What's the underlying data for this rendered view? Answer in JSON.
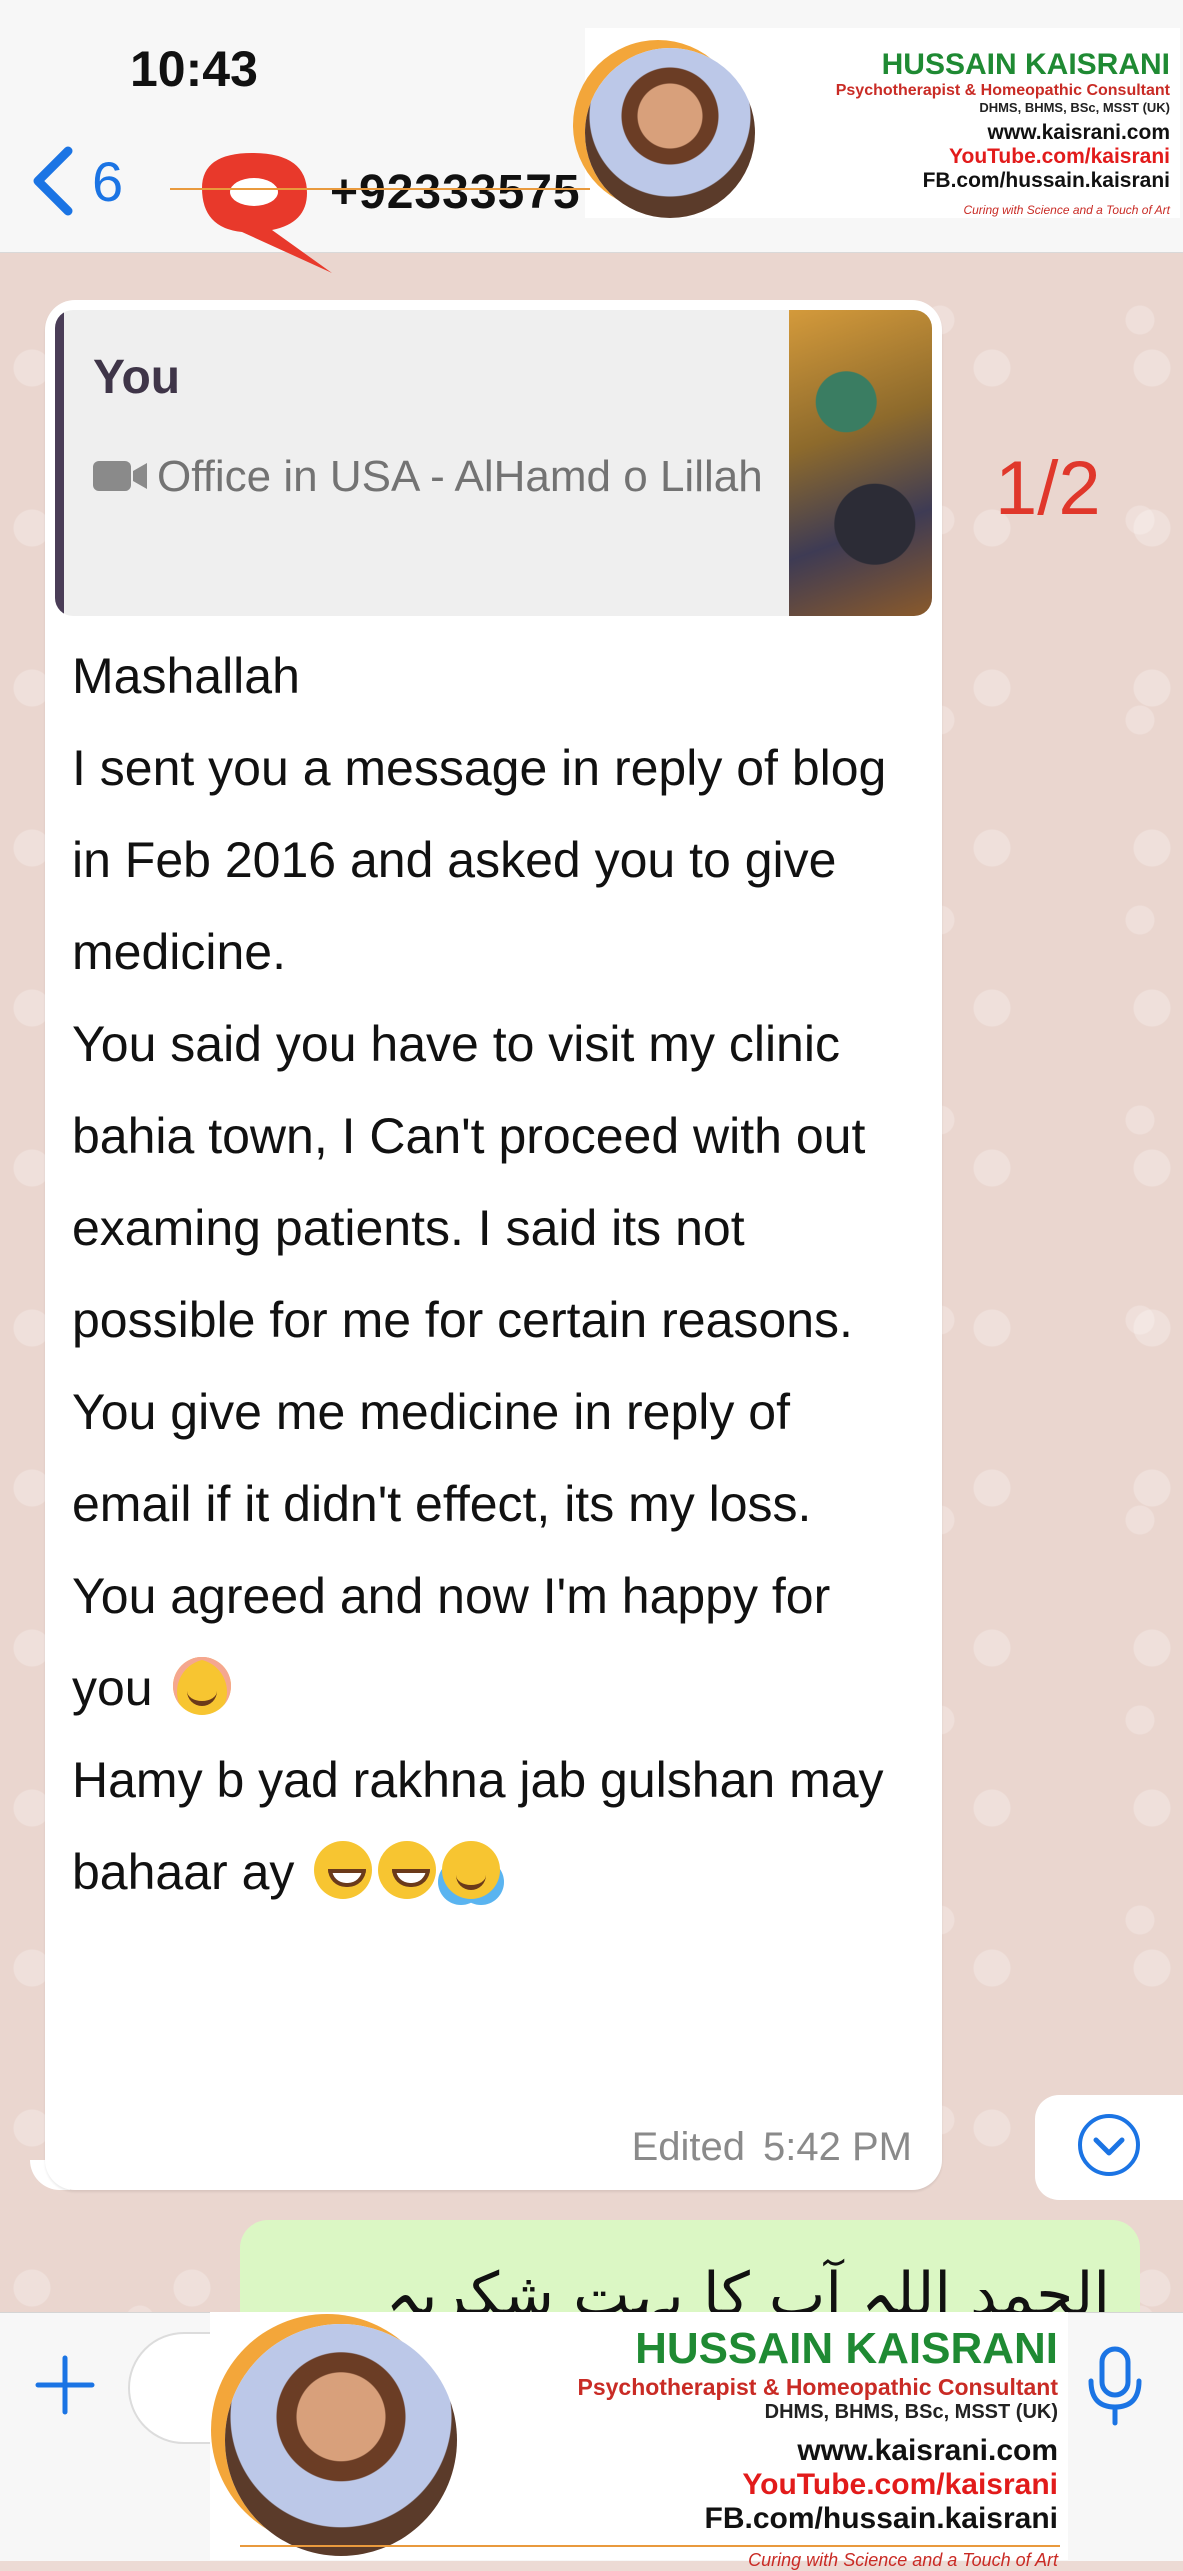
{
  "status_bar": {
    "time": "10:43"
  },
  "header": {
    "back_count": "6",
    "contact_name": "+92333575"
  },
  "brand": {
    "name": "HUSSAIN KAISRANI",
    "tagline": "Psychotherapist & Homeopathic Consultant",
    "degrees": "DHMS, BHMS, BSc, MSST (UK)",
    "website": "www.kaisrani.com",
    "youtube": "YouTube.com/kaisrani",
    "facebook": "FB.com/hussain.kaisrani",
    "motto": "Curing with Science and a Touch of Art"
  },
  "page_indicator": "1/2",
  "message": {
    "quote": {
      "author": "You",
      "text": "Office in USA  - AlHamd o Lillah",
      "icon": "video-icon"
    },
    "lines": [
      "Mashallah",
      "I sent you a message in reply of blog in Feb 2016 and asked you to give medicine.",
      "You said you have to visit my clinic bahia town, I Can't proceed with out examing patients. I said its not possible for me for certain reasons.",
      "You give me medicine in reply of email if it didn't effect, its my loss.",
      "You agreed and now I'm happy for you",
      "Hamy b yad rakhna jab gulshan may bahaar ay"
    ],
    "emojis": {
      "smile": "smiling-face-icon",
      "grin": "grinning-face-icon",
      "tears": "tears-of-joy-icon"
    },
    "edited_label": "Edited",
    "time": "5:42 PM"
  },
  "outgoing_preview": "الحمد اللہ آپ کا بہت شکریہ",
  "colors": {
    "accent": "#1b74e4",
    "indicator": "#e0372b",
    "brand_green": "#1f8a33",
    "brand_red": "#c92b25"
  }
}
